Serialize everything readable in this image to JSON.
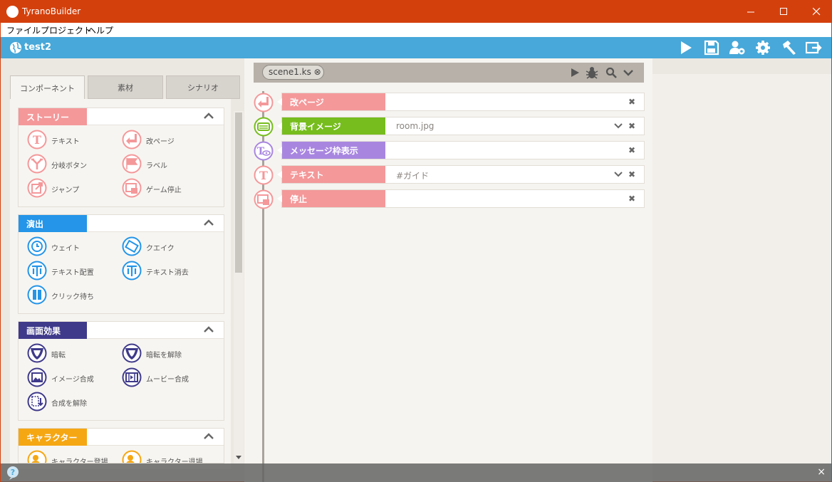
{
  "window": {
    "title": "TyranoBuilder"
  },
  "menu": [
    "ファイル",
    "プロジェクト",
    "ヘルプ"
  ],
  "project": {
    "name": "test2"
  },
  "tabs": [
    "コンポーネント",
    "素材",
    "シナリオ"
  ],
  "sections": [
    {
      "label": "ストーリー",
      "color": "#f4989a",
      "items": [
        "テキスト",
        "改ページ",
        "分岐ボタン",
        "ラベル",
        "ジャンプ",
        "ゲーム停止"
      ]
    },
    {
      "label": "演出",
      "color": "#2495e8",
      "items": [
        "ウェイト",
        "クエイク",
        "テキスト配置",
        "テキスト消去",
        "クリック待ち"
      ]
    },
    {
      "label": "画面効果",
      "color": "#3f3a8a",
      "items": [
        "暗転",
        "暗転を解除",
        "イメージ合成",
        "ムービー合成",
        "合成を解除"
      ]
    },
    {
      "label": "キャラクター",
      "color": "#f5a713",
      "items": [
        "キャラクター登場",
        "キャラクター退場"
      ]
    }
  ],
  "editor": {
    "file_tab": "scene1.ks ⊗",
    "rows": [
      {
        "label": "改ページ",
        "value": "",
        "color": "#f4989a",
        "dropdown": false
      },
      {
        "label": "背景イメージ",
        "value": "room.jpg",
        "color": "#76bd1d",
        "dropdown": true
      },
      {
        "label": "メッセージ枠表示",
        "value": "",
        "color": "#a886e0",
        "dropdown": false
      },
      {
        "label": "テキスト",
        "value": "#ガイド",
        "color": "#f4989a",
        "dropdown": true
      },
      {
        "label": "停止",
        "value": "",
        "color": "#f4989a",
        "dropdown": false
      }
    ]
  },
  "status": {
    "help_icon": "?",
    "close": "×"
  }
}
